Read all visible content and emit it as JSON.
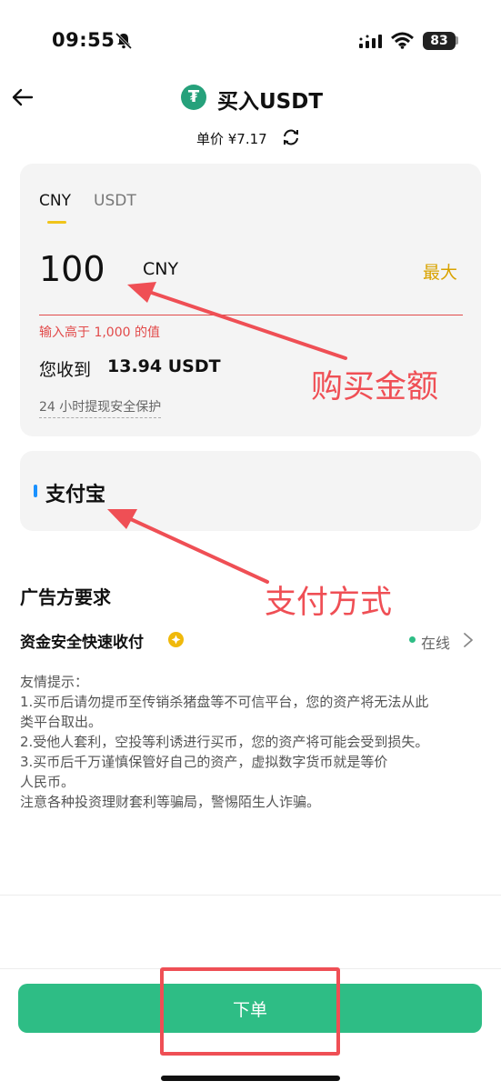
{
  "status_bar": {
    "time": "09:55",
    "battery": "83"
  },
  "header": {
    "title": "买入USDT",
    "coin_symbol": "₮",
    "price": "单价 ¥7.17"
  },
  "amount_card": {
    "tabs": [
      {
        "label": "CNY",
        "active": true
      },
      {
        "label": "USDT",
        "active": false
      }
    ],
    "amount": "100",
    "unit": "CNY",
    "max_label": "最大",
    "error": "输入高于 1,000 的值",
    "receive_label": "您收到",
    "receive_value": "13.94 USDT",
    "protection": "24 小时提现安全保护"
  },
  "payment": {
    "method": "支付宝"
  },
  "annotations": {
    "amount": "购买金额",
    "payment": "支付方式"
  },
  "requirements": {
    "title": "广告方要求",
    "item": "资金安全快速收付",
    "status": "在线",
    "tips": [
      "友情提示：",
      "1.买币后请勿提币至传销杀猪盘等不可信平台，您的资产将无法从此",
      "类平台取出。",
      "2.受他人套利，空投等利诱进行买币，您的资产将可能会受到损失。",
      "3.买币后千万谨慎保管好自己的资产，虚拟数字货币就是等价",
      "人民币。",
      "注意各种投资理财套利等骗局，警惕陌生人诈骗。"
    ]
  },
  "order_button": {
    "label": "下单"
  },
  "colors": {
    "accent": "#2ebd85",
    "error": "#e24a4a",
    "highlight": "#f0c419",
    "annotation": "#ef4f55"
  }
}
